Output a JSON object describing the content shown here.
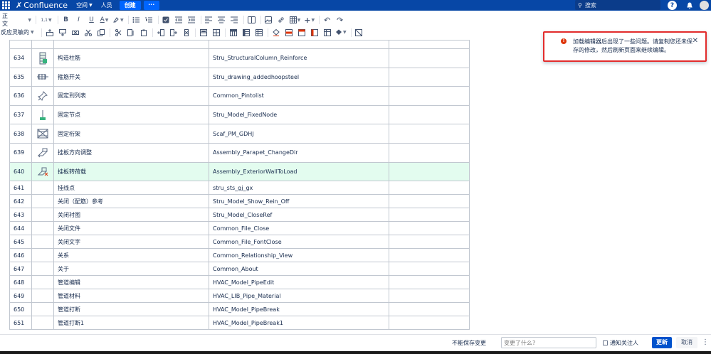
{
  "header": {
    "brand": "Confluence",
    "spaces_label": "空间",
    "people_label": "人员",
    "create_label": "创建",
    "more_label": "···",
    "search_placeholder": "搜索",
    "help_glyph": "?",
    "bell_glyph": "🔔"
  },
  "toolbar": {
    "paragraph_style": "正文",
    "format_button": "反应灵敏的",
    "line_spacing": "1,1",
    "bold": "B",
    "italic": "I",
    "underline": "U",
    "color_text": "A",
    "plus": "+",
    "undo": "↶",
    "redo": "↷"
  },
  "rows": [
    {
      "num": "634",
      "icon": "structural-column-reinforce-icon",
      "name": "构造柱筋",
      "cmd": "Stru_StructuralColumn_Reinforce",
      "tall": true
    },
    {
      "num": "635",
      "icon": "hoop-steel-icon",
      "name": "箍筋开关",
      "cmd": "Stru_drawing_addedhoopsteel",
      "tall": true
    },
    {
      "num": "636",
      "icon": "pin-icon",
      "name": "固定到列表",
      "cmd": "Common_Pintolist",
      "tall": true
    },
    {
      "num": "637",
      "icon": "fixed-node-icon",
      "name": "固定节点",
      "cmd": "Stru_Model_FixedNode",
      "tall": true
    },
    {
      "num": "638",
      "icon": "scaffold-frame-icon",
      "name": "固定桁架",
      "cmd": "Scaf_PM_GDHJ",
      "tall": true
    },
    {
      "num": "639",
      "icon": "parapet-direction-icon",
      "name": "挂板方向调整",
      "cmd": "Assembly_Parapet_ChangeDir",
      "tall": true
    },
    {
      "num": "640",
      "icon": "wall-to-load-icon",
      "name": "挂板转荷载",
      "cmd": "Assembly_ExteriorWallToLoad",
      "tall": true,
      "highlight": true
    },
    {
      "num": "641",
      "icon": "",
      "name": "挂线点",
      "cmd": "stru_sts_gj_gx"
    },
    {
      "num": "642",
      "icon": "",
      "name": "关闭（配筋）参考",
      "cmd": "Stru_Model_Show_Rein_Off"
    },
    {
      "num": "643",
      "icon": "",
      "name": "关闭衬图",
      "cmd": "Stru_Model_CloseRef"
    },
    {
      "num": "644",
      "icon": "",
      "name": "关闭文件",
      "cmd": "Common_File_Close"
    },
    {
      "num": "645",
      "icon": "",
      "name": "关闭文字",
      "cmd": "Common_File_FontClose"
    },
    {
      "num": "646",
      "icon": "",
      "name": "关系",
      "cmd": "Common_Relationship_View"
    },
    {
      "num": "647",
      "icon": "",
      "name": "关于",
      "cmd": "Common_About"
    },
    {
      "num": "648",
      "icon": "",
      "name": "管道编辑",
      "cmd": "HVAC_Model_PipeEdit"
    },
    {
      "num": "649",
      "icon": "",
      "name": "管道材料",
      "cmd": "HVAC_LIB_Pipe_Material"
    },
    {
      "num": "650",
      "icon": "",
      "name": "管道打断",
      "cmd": "HVAC_Model_PipeBreak"
    },
    {
      "num": "651",
      "icon": "",
      "name": "管道打断1",
      "cmd": "HVAC_Model_PipeBreak1"
    }
  ],
  "flag": {
    "message": "加载编辑器后出现了一些问题。请复制您还未保存的修改，然后刷新页面来继续编辑。",
    "error_glyph": "!",
    "close_glyph": "✕"
  },
  "footer": {
    "cannot_save": "不能保存变更",
    "what_changed_placeholder": "变更了什么?",
    "notify_watchers": "通知关注人",
    "update": "更新",
    "cancel": "取消",
    "more": "⋮"
  },
  "colors": {
    "nav_bg": "#0747a6",
    "primary": "#0052cc",
    "error": "#de350b",
    "highlight_row": "#e3fcef"
  }
}
